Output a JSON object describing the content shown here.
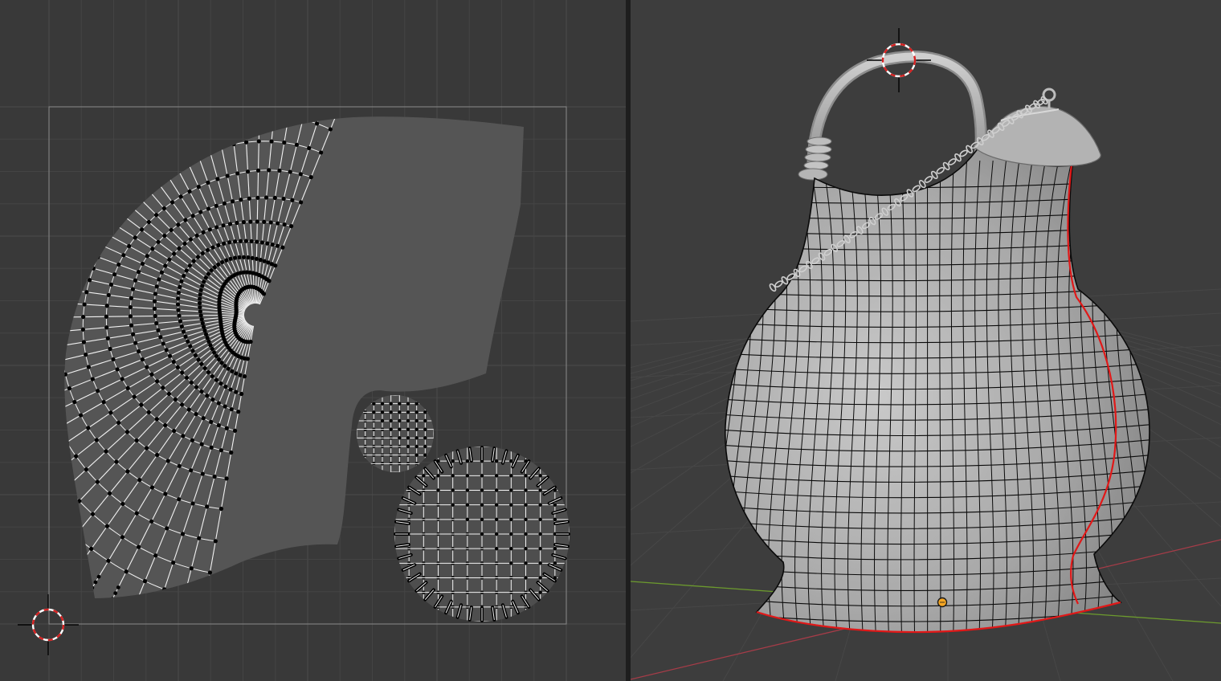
{
  "app": {
    "layout": "split-editors",
    "editors": [
      "uv-editor",
      "3d-viewport"
    ]
  },
  "colors": {
    "uv_background": "#393939",
    "uv_grid_minor": "#444444",
    "uv_grid_major": "#4c4c4c",
    "uv_bounds": "#8a8a8a",
    "uv_edge": "#f2f2f2",
    "uv_vertex": "#000000",
    "viewport_background": "#3d3d3d",
    "floor_grid": "#474747",
    "axis_x": "#a63c48",
    "axis_y": "#6c9a2e",
    "mesh_surface": "#b9b9b9",
    "wire": "#0a0a0a",
    "seam": "#e11818",
    "origin": "#f5a623",
    "cursor_ring_red": "#d62020",
    "cursor_ring_white": "#ffffff"
  },
  "icons": {
    "uv_cursor": "2d-cursor-icon",
    "viewport_cursor": "3d-cursor-icon",
    "object_origin": "origin-point-icon"
  }
}
